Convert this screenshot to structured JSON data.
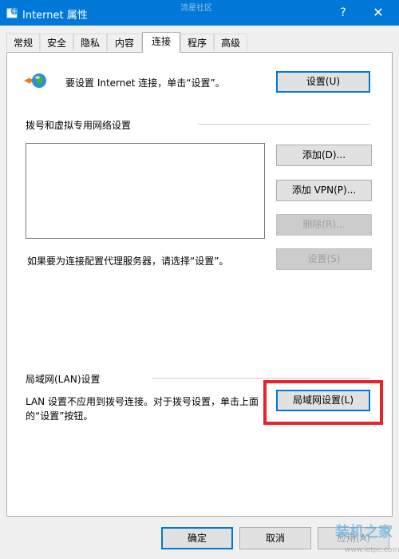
{
  "window": {
    "title": "Internet 属性",
    "watermark": "流星社区",
    "help_glyph": "?",
    "close_glyph": "✕"
  },
  "tabs": [
    {
      "label": "常规"
    },
    {
      "label": "安全"
    },
    {
      "label": "隐私"
    },
    {
      "label": "内容"
    },
    {
      "label": "连接",
      "active": true
    },
    {
      "label": "程序"
    },
    {
      "label": "高级"
    }
  ],
  "connection": {
    "setup_text": "要设置 Internet 连接，单击“设置”。",
    "setup_button": "设置(U)"
  },
  "dialup": {
    "heading": "拨号和虚拟专用网络设置",
    "add_button": "添加(D)...",
    "add_vpn_button": "添加 VPN(P)...",
    "remove_button": "删除(R)...",
    "proxy_text": "如果要为连接配置代理服务器，请选择“设置”。",
    "settings_button": "设置(S)"
  },
  "lan": {
    "heading": "局域网(LAN)设置",
    "description_line1": "LAN 设置不应用到拨号连接。对于拨号设置，单击上面",
    "description_line2": "的“设置”按钮。",
    "lan_button": "局域网设置(L)"
  },
  "footer": {
    "ok_button": "确定",
    "cancel_button": "取消",
    "apply_button": "应用(A)"
  },
  "watermark_logo": {
    "text": "装机之家",
    "url": "www.lotpc.com"
  },
  "colors": {
    "titlebar": "#0078d7",
    "highlight": "#e8232a"
  }
}
